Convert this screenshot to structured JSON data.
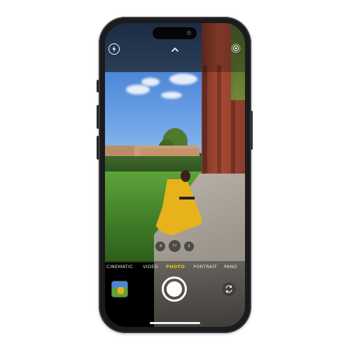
{
  "camera": {
    "zoom_options": [
      {
        "label": ".5"
      },
      {
        "label": "1x"
      },
      {
        "label": "2"
      }
    ],
    "modes": [
      {
        "label": "CINEMATIC"
      },
      {
        "label": "VIDEO"
      },
      {
        "label": "PHOTO",
        "active": true
      },
      {
        "label": "PORTRAIT"
      },
      {
        "label": "PANO"
      }
    ]
  },
  "icons": {
    "flash": "flash-icon",
    "controls_toggle": "chevron-up-icon",
    "live_photo": "live-photo-icon",
    "camera_flip": "camera-flip-icon"
  },
  "colors": {
    "active_mode": "#f5c518",
    "ui_text": "#ffffff",
    "phone_body": "#1b1b1d"
  }
}
